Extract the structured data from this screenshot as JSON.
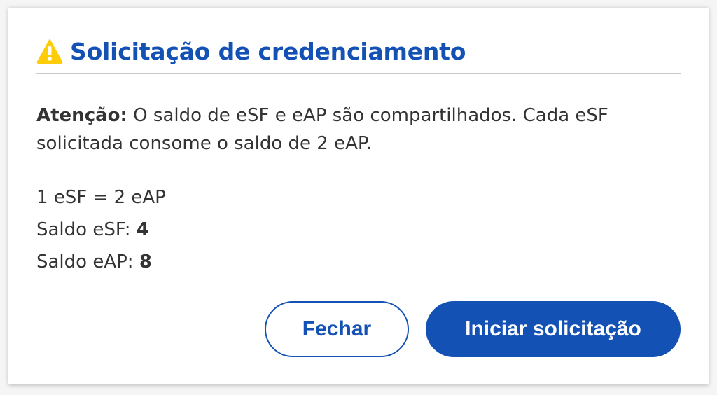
{
  "dialog": {
    "title": "Solicitação de credenciamento",
    "icon": "warning-icon",
    "attention_label": "Atenção:",
    "attention_text": " O saldo de eSF e eAP são compartilhados. Cada eSF solicitada consome o saldo de 2 eAP.",
    "equivalence": "1 eSF = 2 eAP",
    "esf_balance_label": "Saldo eSF: ",
    "esf_balance_value": "4",
    "eap_balance_label": "Saldo eAP: ",
    "eap_balance_value": "8",
    "close_button": "Fechar",
    "start_button": "Iniciar solicitação"
  },
  "colors": {
    "primary": "#1351b4",
    "warning": "#ffcd07",
    "text": "#333333",
    "divider": "#c9c9c9"
  }
}
